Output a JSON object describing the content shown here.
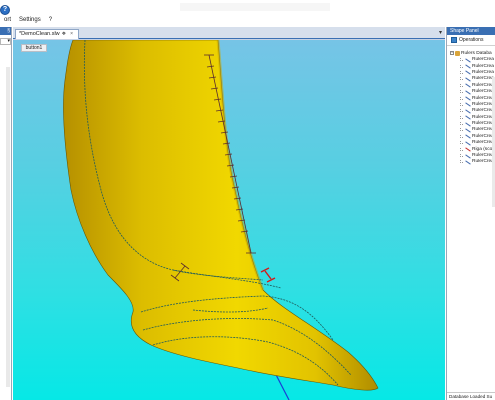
{
  "menu": {
    "items": [
      "ort",
      "Settings",
      "?"
    ]
  },
  "left_panel": {
    "header_label": "§",
    "combo_label": "▾"
  },
  "document": {
    "tab_label": "*DemoClean.slw",
    "close_glyph": "×",
    "pin_glyph": "❖",
    "dropdown_glyph": "▾",
    "button1_label": "button1"
  },
  "shape_panel": {
    "title": "Shape Panel",
    "operations_label": "Operations",
    "tree_root_label": "Rulers Databa",
    "tree_items": [
      {
        "label": "RulerCrea",
        "icon": "ruler-icon"
      },
      {
        "label": "RulerCrea",
        "icon": "ruler-icon"
      },
      {
        "label": "RulerCrea",
        "icon": "ruler-icon"
      },
      {
        "label": "RulerCrea",
        "icon": "ruler-icon"
      },
      {
        "label": "RulerCrea",
        "icon": "ruler-icon"
      },
      {
        "label": "RulerCrea",
        "icon": "ruler-icon"
      },
      {
        "label": "RulerCrea",
        "icon": "ruler-icon"
      },
      {
        "label": "RulerCrea",
        "icon": "ruler-icon"
      },
      {
        "label": "RulerCrea",
        "icon": "ruler-icon"
      },
      {
        "label": "RulerCrea",
        "icon": "ruler-icon"
      },
      {
        "label": "RulerCrea",
        "icon": "ruler-icon"
      },
      {
        "label": "RulerCrea",
        "icon": "ruler-icon"
      },
      {
        "label": "RulerCrea",
        "icon": "ruler-icon"
      },
      {
        "label": "RulerCrea",
        "icon": "ruler-icon"
      },
      {
        "label": "Riga (scos",
        "icon": "ruler-icon-red"
      },
      {
        "label": "RulerCrea",
        "icon": "ruler-icon"
      },
      {
        "label": "RulerCrea",
        "icon": "ruler-icon"
      }
    ],
    "status_text": "Database Loaded Su"
  },
  "colors": {
    "accent": "#3a6fb3",
    "viewport_top": "#76c4e6",
    "viewport_bottom": "#06e8e6",
    "model_fill": "#e3c400",
    "seam_line": "#1f5b5b",
    "highlight_ruler": "#d21a1a"
  }
}
